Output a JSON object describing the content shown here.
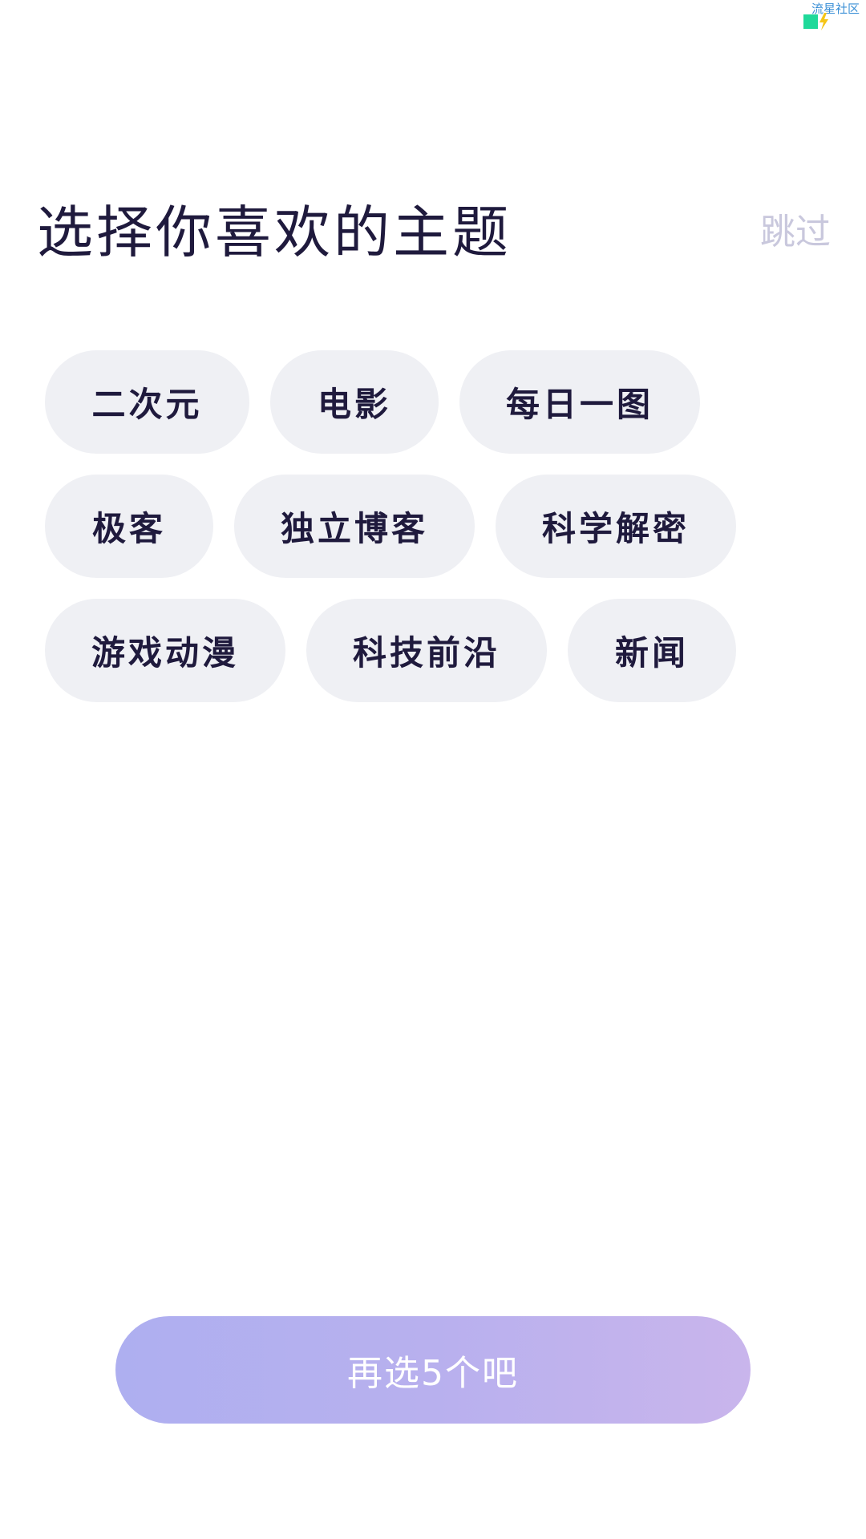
{
  "watermark": {
    "text": "流星社区",
    "icon": "lightning-logo-icon"
  },
  "header": {
    "title": "选择你喜欢的主题",
    "skip_label": "跳过"
  },
  "topics": {
    "row1": [
      "二次元",
      "电影",
      "每日一图"
    ],
    "row2": [
      "极客",
      "独立博客",
      "科学解密"
    ],
    "row3": [
      "游戏动漫",
      "科技前沿",
      "新闻"
    ]
  },
  "submit": {
    "label": "再选5个吧"
  },
  "colors": {
    "title": "#1f1a3d",
    "chip_bg": "#eff0f4",
    "skip": "#c9c8dd",
    "button_gradient_start": "#aeaff0",
    "button_gradient_end": "#c9b5ec"
  }
}
